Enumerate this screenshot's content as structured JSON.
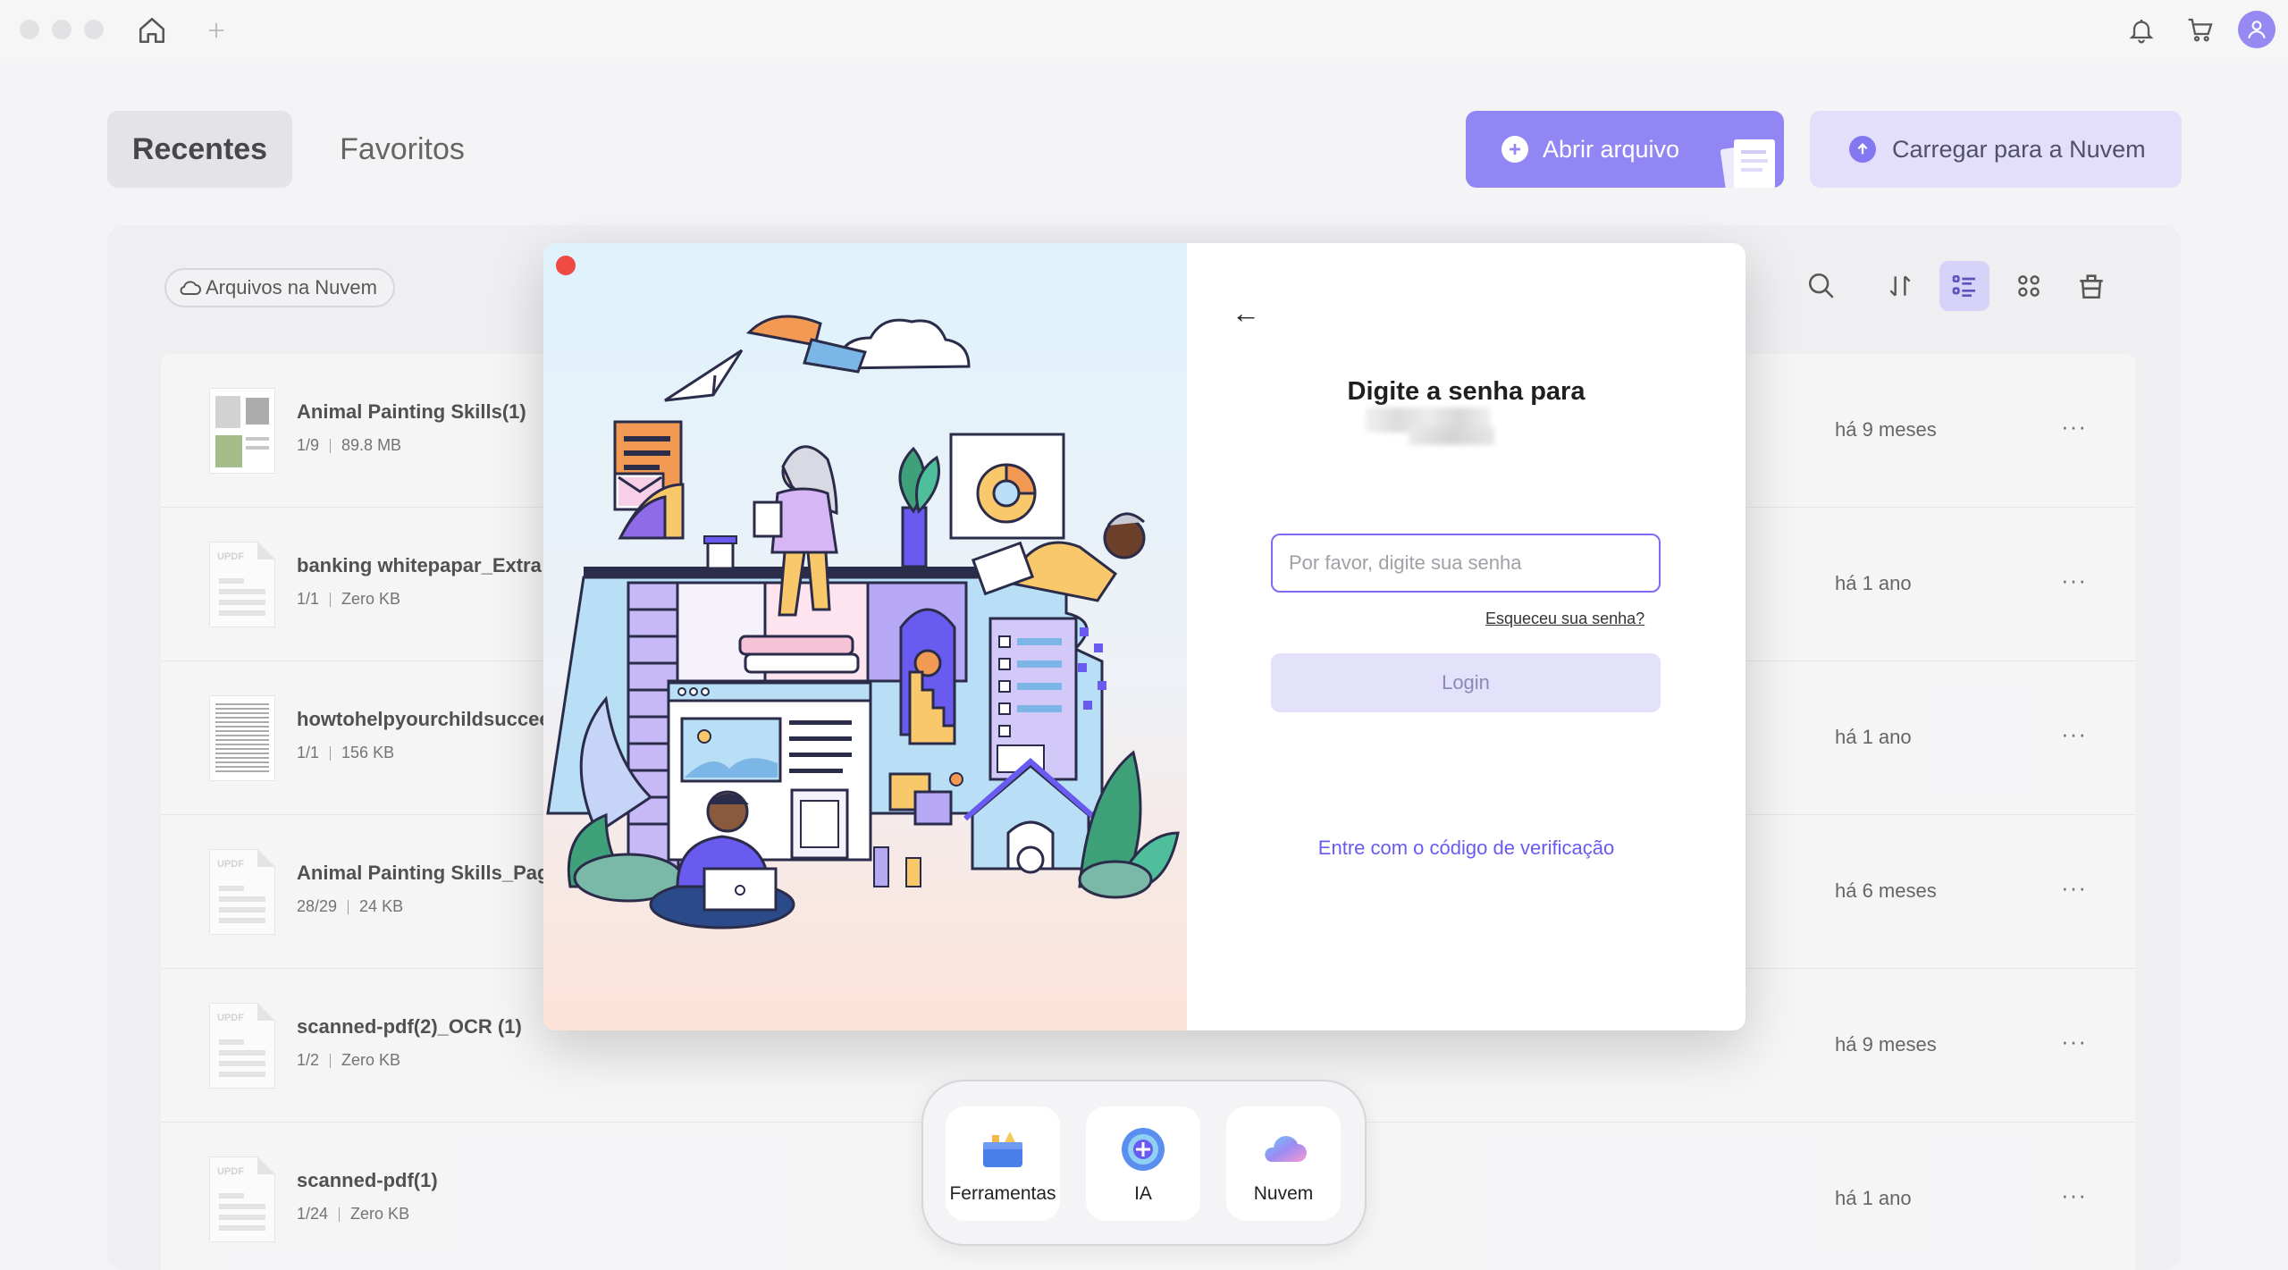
{
  "window": {
    "traffic_lights": [
      "close",
      "minimize",
      "zoom"
    ]
  },
  "header": {
    "tabs": [
      {
        "label": "Recentes",
        "active": true
      },
      {
        "label": "Favoritos",
        "active": false
      }
    ],
    "open_button": "Abrir arquivo",
    "cloud_button": "Carregar para a Nuvem"
  },
  "toolbar": {
    "cloud_chip": "Arquivos na Nuvem"
  },
  "files": [
    {
      "name": "Animal Painting Skills(1)",
      "pages": "1/9",
      "size": "89.8 MB",
      "time": "há 9 meses"
    },
    {
      "name": "banking whitepapar_Extra",
      "pages": "1/1",
      "size": "Zero KB",
      "time": "há 1 ano"
    },
    {
      "name": "howtohelpyourchildsuccee",
      "pages": "1/1",
      "size": "156 KB",
      "time": "há 1 ano"
    },
    {
      "name": "Animal Painting Skills_Pag",
      "pages": "28/29",
      "size": "24 KB",
      "time": "há 6 meses"
    },
    {
      "name": "scanned-pdf(2)_OCR (1)",
      "pages": "1/2",
      "size": "Zero KB",
      "time": "há 9 meses"
    },
    {
      "name": "scanned-pdf(1)",
      "pages": "1/24",
      "size": "Zero KB",
      "time": "há 1 ano"
    }
  ],
  "thumb_label": "UPDF",
  "more_glyph": "···",
  "modal": {
    "title": "Digite a senha para",
    "password_placeholder": "Por favor, digite sua senha",
    "forgot": "Esqueceu sua senha?",
    "login": "Login",
    "verify_link": "Entre com o código de verificação",
    "back_glyph": "←"
  },
  "dock": [
    {
      "label": "Ferramentas"
    },
    {
      "label": "IA"
    },
    {
      "label": "Nuvem"
    }
  ],
  "colors": {
    "accent": "#7b6cf2",
    "accent_light": "#ddd8fb",
    "close_red": "#ef4b43",
    "link": "#6a5bf0"
  }
}
